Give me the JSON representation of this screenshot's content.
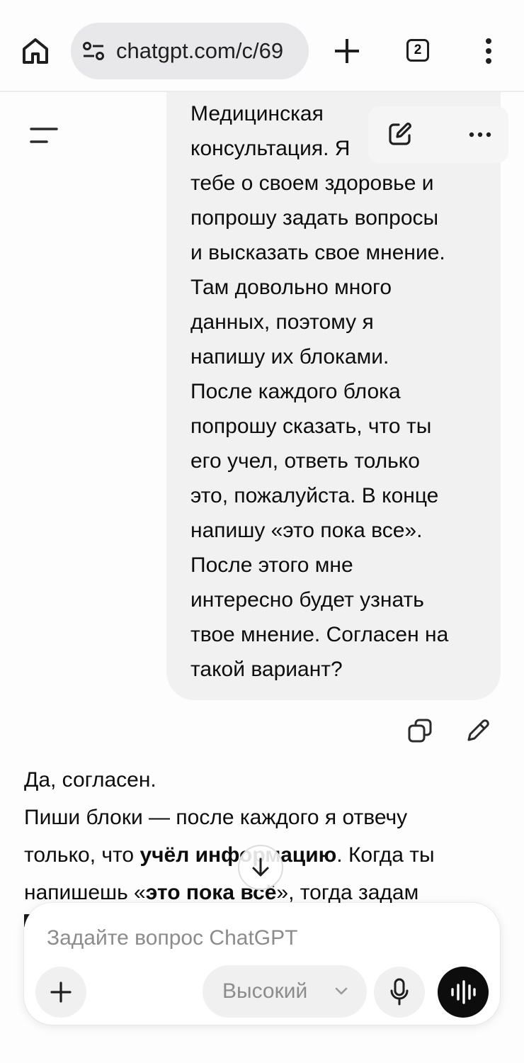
{
  "browser": {
    "url": "chatgpt.com/c/69",
    "tab_count": "2",
    "icons": [
      "home-icon",
      "site-settings-icon",
      "plus-icon",
      "tabs-icon",
      "more-vert-icon"
    ]
  },
  "header": {
    "icons": [
      "sidebar-menu-icon",
      "new-chat-icon",
      "more-horizontal-icon"
    ]
  },
  "user_message": {
    "lines": [
      "Медицинская",
      "консультация. Я",
      "тебе о своем здоровье и",
      "попрошу задать вопросы",
      "и высказать свое мнение.",
      "Там довольно много",
      "данных, поэтому я",
      "напишу их блоками.",
      "После каждого блока",
      "попрошу сказать, что ты",
      "его учел, ответь только",
      "это, пожалуйста. В конце",
      "напишу «это пока все».",
      "После этого мне",
      "интересно будет узнать",
      "твое мнение. Согласен на",
      "такой вариант?"
    ],
    "actions": [
      "copy-icon",
      "edit-icon"
    ]
  },
  "assistant_message": {
    "line1": "Да, согласен.",
    "line2": "Пиши блоки — после каждого я отвечу",
    "line3_a": "только, что ",
    "line3_b": "учёл информацию",
    "line3_c": ". Когда ты",
    "line4_a": "напишешь «",
    "line4_b": "это пока всё",
    "line4_c": "», тогда задам"
  },
  "composer": {
    "placeholder": "Задайте вопрос ChatGPT",
    "model_label": "Высокий",
    "icons": [
      "plus-icon",
      "chevron-down-icon",
      "microphone-icon",
      "voice-mode-icon",
      "arrow-down-icon"
    ]
  },
  "colors": {
    "bubble": "#f1f1f1",
    "pill": "#e8e8ea",
    "text": "#0d0d0d",
    "placeholder": "#8c8c8c",
    "voice_button": "#0d0d0d"
  }
}
